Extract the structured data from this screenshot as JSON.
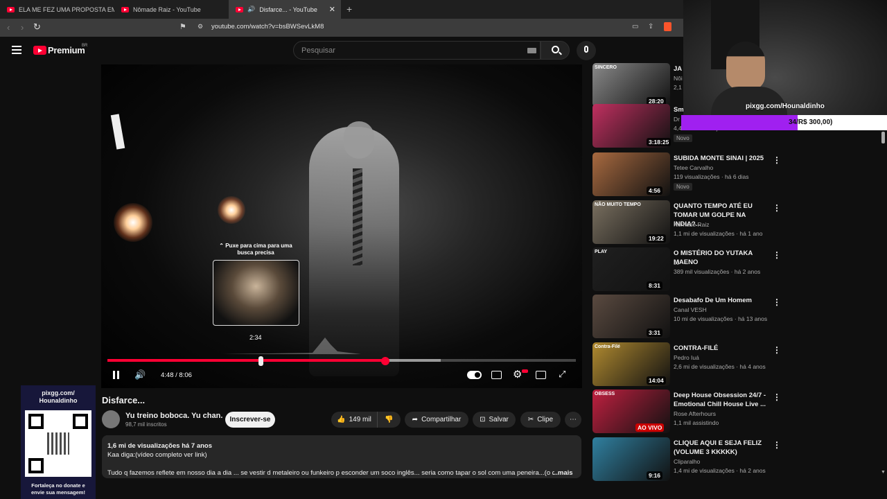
{
  "tabs": [
    {
      "label": "ELA ME FEZ UMA PROPOSTA EM TÓ"
    },
    {
      "label": "Nômade Raiz - YouTube"
    },
    {
      "label": "Disfarce... - YouTube"
    }
  ],
  "address": {
    "url": "youtube.com/watch?v=bsBWSevLkM8"
  },
  "header": {
    "brand": "Premium",
    "region": "BR",
    "search_placeholder": "Pesquisar"
  },
  "player": {
    "scrub_hint": "Puxe para cima para uma busca precisa",
    "preview_time": "2:34",
    "time": "4:48 / 8:06",
    "progress_played": 0.593,
    "progress_buffered": 0.711
  },
  "video": {
    "title": "Disfarce...",
    "channel": "Yu treino boboca. Yu chan.",
    "subscribers": "98,7 mil inscritos",
    "subscribe_label": "Inscrever-se",
    "likes": "149 mil",
    "share_label": "Compartilhar",
    "save_label": "Salvar",
    "clip_label": "Clipe",
    "stats": "1,6 mi de visualizações  há 7 anos",
    "desc_line1": "Kaa  diga:(vídeo completo ver link)",
    "desc_line2": "Tudo q fazemos  reflete em nosso dia a dia ... se vestir d metaleiro ou funkeiro  p esconder um soco inglês... seria como tapar o sol com uma peneira...(o di",
    "more_label": "...mais"
  },
  "sidebar": [
    {
      "title": "JA",
      "channel": "Nôi",
      "meta": "2,1",
      "duration": "28:20",
      "thumb": "#8a8a8a",
      "thumb_text": "SINCERO"
    },
    {
      "title": "Sm De",
      "channel": "Dr",
      "meta": "4,4 mil visualizações · há 3 dias",
      "duration": "3:18:25",
      "badge": "Novo",
      "thumb": "#c03060"
    },
    {
      "title": "SUBIDA MONTE SINAI | 2025",
      "channel": "Tetee Carvalho",
      "meta": "119 visualizações · há 6 dias",
      "duration": "4:56",
      "badge": "Novo",
      "thumb": "#a86a40"
    },
    {
      "title": "QUANTO TEMPO ATÉ EU TOMAR UM GOLPE NA INDIA?...",
      "channel": "Nômade Raiz",
      "meta": "1,1 mi de visualizações · há 1 ano",
      "duration": "19:22",
      "thumb": "#7a7060",
      "thumb_text": "NÃO MUITO TEMPO"
    },
    {
      "title": "O MISTÉRIO DO YUTAKA MAENO",
      "channel": "JJ",
      "meta": "389 mil visualizações · há 2 anos",
      "duration": "8:31",
      "thumb": "#202020",
      "thumb_text": "PLAY"
    },
    {
      "title": "Desabafo De Um Homem",
      "channel": "Canal VESH",
      "meta": "10 mi de visualizações · há 13 anos",
      "duration": "3:31",
      "thumb": "#5a4a40"
    },
    {
      "title": "CONTRA-FILÉ",
      "channel": "Pedro Iuá",
      "meta": "2,6 mi de visualizações · há 4 anos",
      "duration": "14:04",
      "thumb": "#b08a30",
      "thumb_text": "Contra-Filé"
    },
    {
      "title": "Deep House Obsession 24/7 - Emotional Chill House Live ...",
      "channel": "Rose Afterhours",
      "meta": "1,1 mil assistindo",
      "live": "AO VIVO",
      "thumb": "#c02040",
      "thumb_text": "OBSESS"
    },
    {
      "title": "CLIQUE AQUI E SEJA FELIZ (VOLUME 3 KKKKK)",
      "channel": "Cliparalho",
      "meta": "1,4 mi de visualizações · há 2 anos",
      "duration": "9:16",
      "thumb": "#3080a0"
    }
  ],
  "overlay": {
    "pixgg_label": "pixgg.com/Hounaldinho",
    "pixgg_goal": "/R$ 300,00)",
    "pixgg_goal_prefix": "34",
    "qr_title": "pixgg.com/ Hounaldinho",
    "qr_caption": "Fortaleça no donate e envie sua mensagem!"
  }
}
